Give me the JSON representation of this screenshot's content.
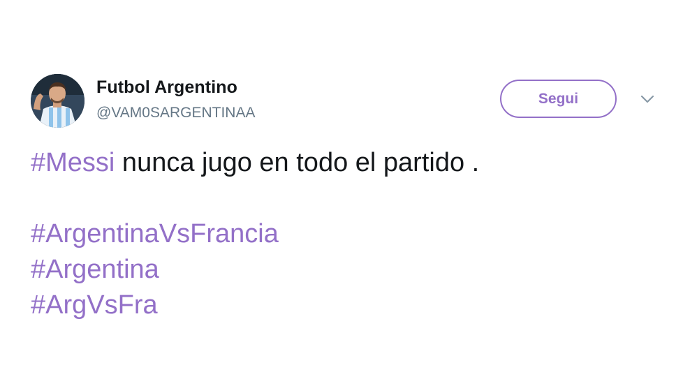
{
  "colors": {
    "accent": "#9370c8",
    "name": "#14171a",
    "handle": "#657786"
  },
  "user": {
    "name": "Futbol Argentino",
    "handle": "@VAM0SARGENTINAA",
    "avatar_icon": "profile-photo"
  },
  "follow_button": {
    "label": "Segui"
  },
  "menu": {
    "icon": "chevron-down-icon"
  },
  "tweet": {
    "line1_hashtag": "#Messi",
    "line1_text": " nunca jugo en todo el partido .",
    "hashtags": [
      "#ArgentinaVsFrancia",
      "#Argentina",
      "#ArgVsFra"
    ]
  }
}
